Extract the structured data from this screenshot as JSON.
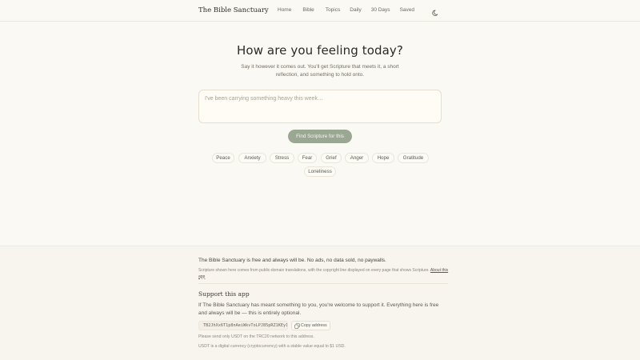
{
  "header": {
    "brand": "The Bible Sanctuary",
    "nav": [
      "Home",
      "Bible",
      "Topics",
      "Daily",
      "30 Days",
      "Saved"
    ],
    "theme_icon": "moon-icon"
  },
  "hero": {
    "title": "How are you feeling today?",
    "subtitle": "Say it however it comes out. You'll get Scripture that meets it, a short reflection, and something to hold onto.",
    "input_placeholder": "I've been carrying something heavy this week…",
    "input_value": "",
    "submit_label": "Find Scripture for this"
  },
  "chips": [
    "Peace",
    "Anxiety",
    "Stress",
    "Fear",
    "Grief",
    "Anger",
    "Hope",
    "Gratitude",
    "Loneliness"
  ],
  "footer": {
    "free_statement": "The Bible Sanctuary is free and always will be. No ads, no data sold, no paywalls.",
    "copyright_note": "Scripture shown here comes from public-domain translations, with the copyright line displayed on every page that shows Scripture.",
    "about_link": "About this app",
    "support_title": "Support this app",
    "support_text": "If The Bible Sanctuary has meant something to you, you're welcome to support it. Everything here is free and always will be — this is entirely optional.",
    "wallet_address": "TB2JhXx6T1p8nAeiWkvToLPJ85pRZ1KEy1",
    "copy_label": "Copy address",
    "copy_icon": "copy-icon",
    "network_note": "Please send only USDT on the TRC20 network to this address.",
    "usdt_note": "USDT is a digital currency (cryptocurrency) with a stable value equal to $1 USD."
  },
  "colors": {
    "background": "#fbf9f4",
    "accent_button": "#9aa893",
    "footer_background": "#f8f5ef",
    "text": "#2c2a25"
  }
}
